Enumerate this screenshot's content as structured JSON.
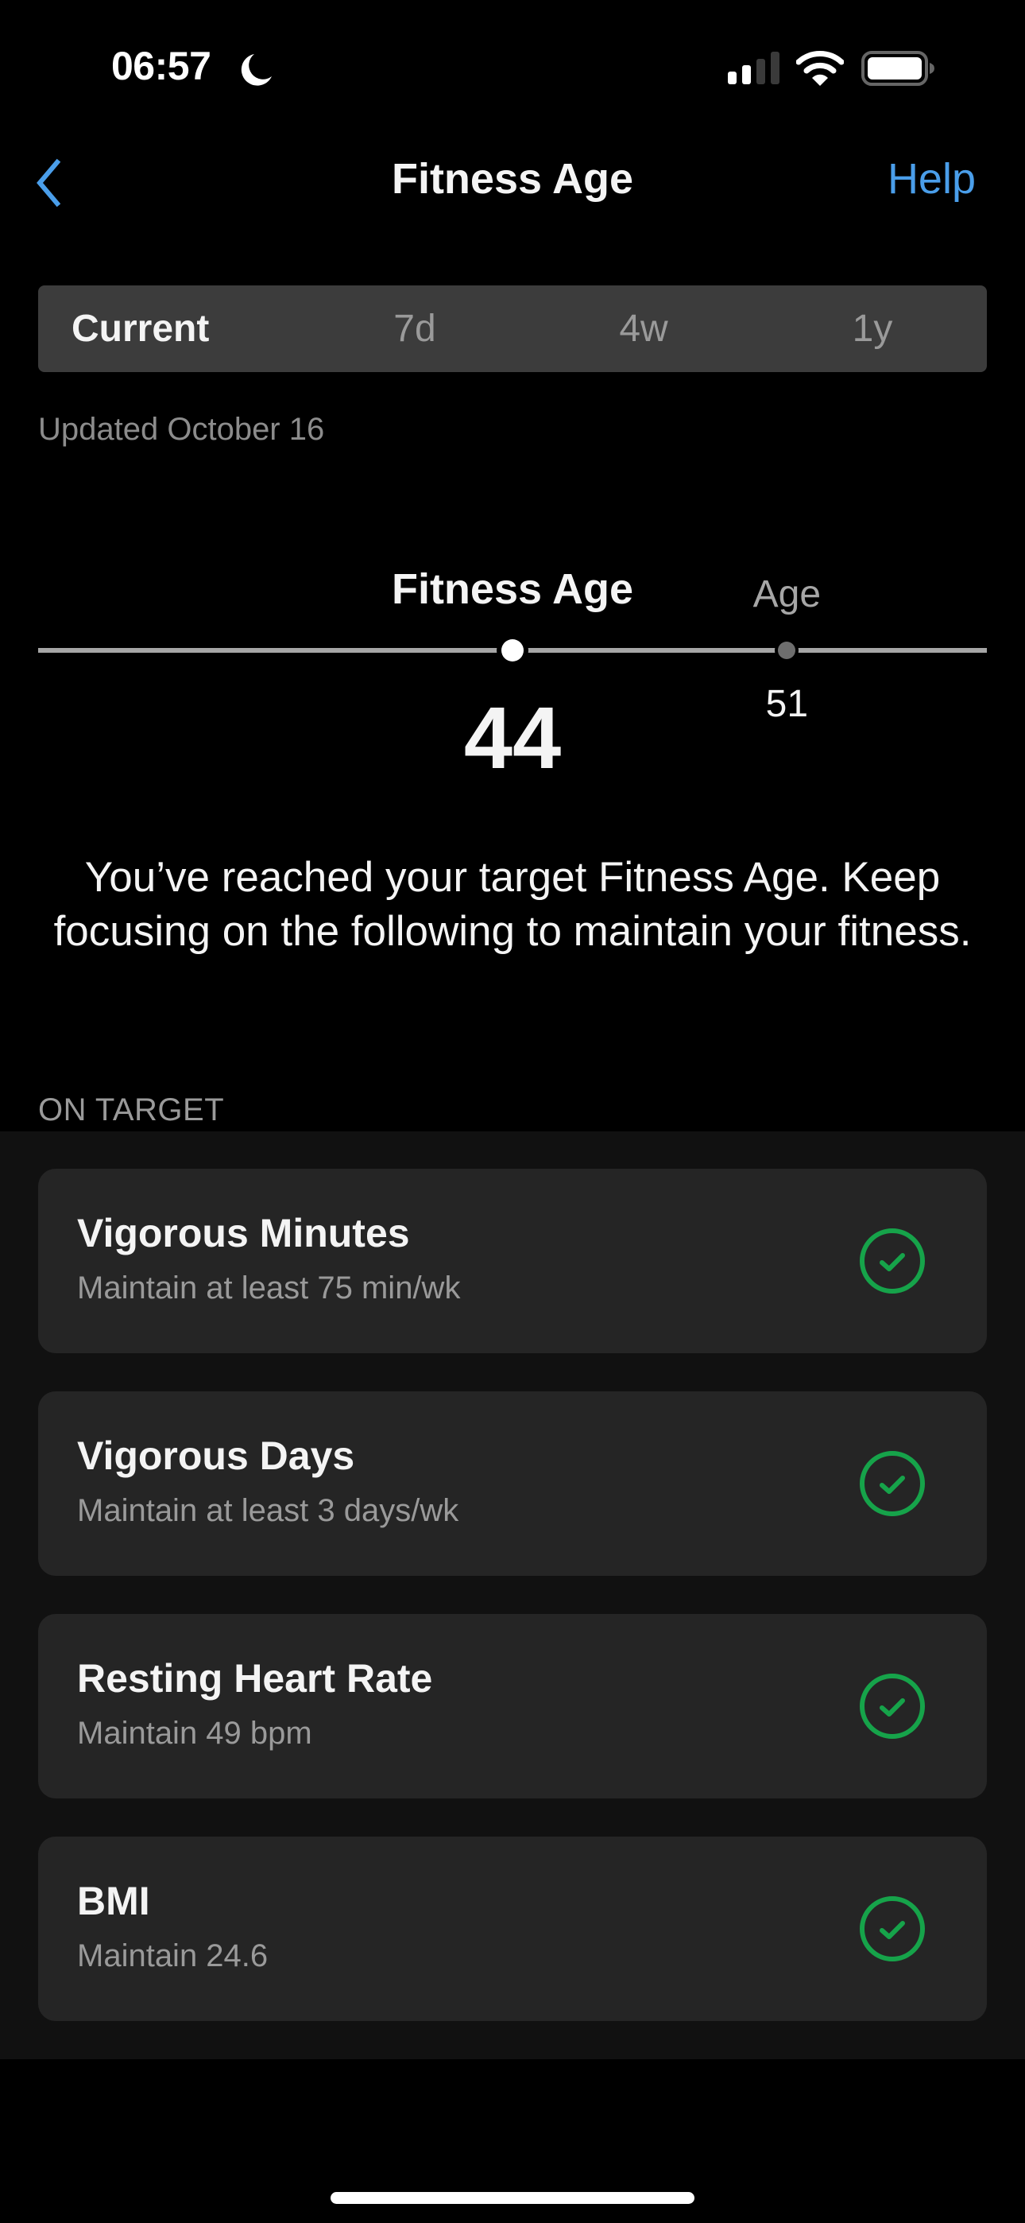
{
  "status_bar": {
    "time": "06:57",
    "focus_icon": "moon-icon",
    "signal_icon": "cellular-signal-icon",
    "signal_bars_active": 2,
    "signal_bars_total": 4,
    "wifi_icon": "wifi-icon",
    "battery_icon": "battery-icon"
  },
  "nav": {
    "back_icon": "chevron-left-icon",
    "title": "Fitness Age",
    "help_label": "Help"
  },
  "tabs": [
    {
      "label": "Current",
      "active": true
    },
    {
      "label": "7d",
      "active": false
    },
    {
      "label": "4w",
      "active": false
    },
    {
      "label": "1y",
      "active": false
    }
  ],
  "updated_text": "Updated October 16",
  "gauge": {
    "fitness_age_label": "Fitness Age",
    "fitness_age_value": 44,
    "age_label": "Age",
    "age_value": 51
  },
  "message": "You’ve reached your target Fitness Age. Keep focusing on the following to maintain your fitness.",
  "section_header": "ON TARGET",
  "items": [
    {
      "title": "Vigorous Minutes",
      "subtitle": "Maintain at least 75 min/wk",
      "status_icon": "check-circle-icon",
      "status": "on-target"
    },
    {
      "title": "Vigorous Days",
      "subtitle": "Maintain at least 3 days/wk",
      "status_icon": "check-circle-icon",
      "status": "on-target"
    },
    {
      "title": "Resting Heart Rate",
      "subtitle": "Maintain 49 bpm",
      "status_icon": "check-circle-icon",
      "status": "on-target"
    },
    {
      "title": "BMI",
      "subtitle": "Maintain 24.6",
      "status_icon": "check-circle-icon",
      "status": "on-target"
    }
  ],
  "colors": {
    "accent": "#4a9eea",
    "success": "#16a34a",
    "card": "#252525",
    "section_bg": "#111111"
  }
}
